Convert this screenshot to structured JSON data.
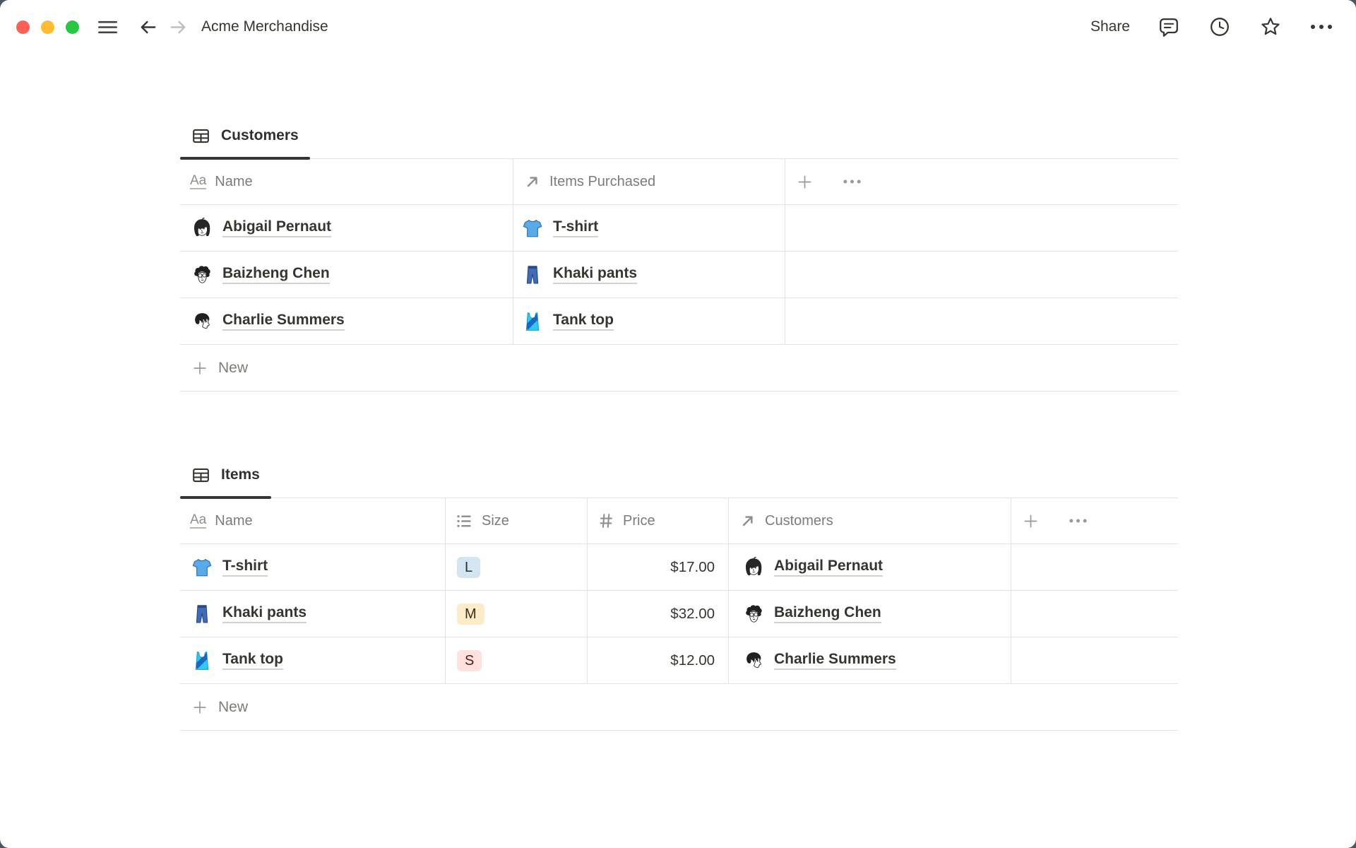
{
  "titlebar": {
    "title": "Acme Merchandise",
    "share": "Share"
  },
  "customers": {
    "tab": "Customers",
    "columns": {
      "name": "Name",
      "items_purchased": "Items Purchased"
    },
    "rows": [
      {
        "name": "Abigail Pernaut",
        "item": "T-shirt"
      },
      {
        "name": "Baizheng Chen",
        "item": "Khaki pants"
      },
      {
        "name": "Charlie Summers",
        "item": "Tank top"
      }
    ],
    "new_label": "New"
  },
  "items": {
    "tab": "Items",
    "columns": {
      "name": "Name",
      "size": "Size",
      "price": "Price",
      "customers": "Customers"
    },
    "rows": [
      {
        "name": "T-shirt",
        "size": "L",
        "size_color": "blue",
        "price": "$17.00",
        "customer": "Abigail Pernaut"
      },
      {
        "name": "Khaki pants",
        "size": "M",
        "size_color": "yellow",
        "price": "$32.00",
        "customer": "Baizheng Chen"
      },
      {
        "name": "Tank top",
        "size": "S",
        "size_color": "red",
        "price": "$12.00",
        "customer": "Charlie Summers"
      }
    ],
    "new_label": "New"
  },
  "icons": {
    "aa": "Aa"
  },
  "colors": {
    "traffic_red": "#ff5f57",
    "traffic_yellow": "#febc2e",
    "traffic_green": "#28c840",
    "tag_blue_bg": "#d3e5ef",
    "tag_blue_text": "#183347",
    "tag_yellow_bg": "#fdecc8",
    "tag_yellow_text": "#402c1b",
    "tag_red_bg": "#ffe2dd",
    "tag_red_text": "#5d1715"
  }
}
